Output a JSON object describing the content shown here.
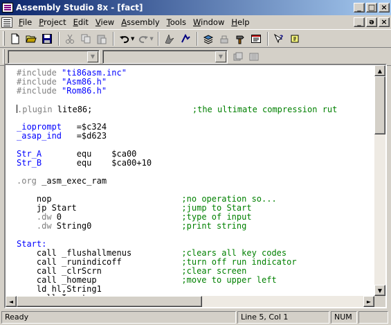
{
  "window": {
    "title": "Assembly Studio 8x - [fact]"
  },
  "caption_buttons": {
    "minimize": "_",
    "maximize": "□",
    "close": "×",
    "restore": "ǝ"
  },
  "menu": [
    {
      "label_u": "F",
      "label_rest": "ile"
    },
    {
      "label_u": "P",
      "label_rest": "roject"
    },
    {
      "label_u": "E",
      "label_rest": "dit"
    },
    {
      "label_u": "V",
      "label_rest": "iew"
    },
    {
      "label_u": "A",
      "label_rest": "ssembly"
    },
    {
      "label_u": "T",
      "label_rest": "ools"
    },
    {
      "label_u": "W",
      "label_rest": "indow"
    },
    {
      "label_u": "H",
      "label_rest": "elp"
    }
  ],
  "toolbar": {
    "icons": [
      "new-file-icon",
      "open-folder-icon",
      "save-icon",
      "cut-icon",
      "copy-icon",
      "paste-icon",
      "undo-icon",
      "redo-icon",
      "find-icon",
      "find-next-icon",
      "stack-icon",
      "build-icon",
      "hammer-icon",
      "window-icon",
      "help-icon",
      "context-help-icon"
    ]
  },
  "combos": {
    "project_value": "",
    "config_value": ""
  },
  "editor": {
    "lines": [
      {
        "segments": [
          {
            "t": "#include ",
            "c": "gray"
          },
          {
            "t": "\"ti86asm.inc\"",
            "c": "blue"
          }
        ]
      },
      {
        "segments": [
          {
            "t": "#include ",
            "c": "gray"
          },
          {
            "t": "\"Asm86.h\"",
            "c": "blue"
          }
        ]
      },
      {
        "segments": [
          {
            "t": "#include ",
            "c": "gray"
          },
          {
            "t": "\"Rom86.h\"",
            "c": "blue"
          }
        ]
      },
      {
        "segments": []
      },
      {
        "segments": [
          {
            "t": "caret",
            "c": "caret"
          },
          {
            "t": ".plugin",
            "c": "gray"
          },
          {
            "t": " lite86;",
            "c": "black"
          },
          {
            "t": "                    ;the ultimate compression rut",
            "c": "green"
          }
        ]
      },
      {
        "segments": []
      },
      {
        "segments": [
          {
            "t": "_ioprompt",
            "c": "blue"
          },
          {
            "t": "   =$c324",
            "c": "black"
          }
        ]
      },
      {
        "segments": [
          {
            "t": "_asap_ind",
            "c": "blue"
          },
          {
            "t": "   =$d623",
            "c": "black"
          }
        ]
      },
      {
        "segments": []
      },
      {
        "segments": [
          {
            "t": "Str_A",
            "c": "blue"
          },
          {
            "t": "       equ    $ca00",
            "c": "black"
          }
        ]
      },
      {
        "segments": [
          {
            "t": "Str_B",
            "c": "blue"
          },
          {
            "t": "       equ    $ca00+10",
            "c": "black"
          }
        ]
      },
      {
        "segments": []
      },
      {
        "segments": [
          {
            "t": ".org",
            "c": "gray"
          },
          {
            "t": " _asm_exec_ram",
            "c": "black"
          }
        ]
      },
      {
        "segments": []
      },
      {
        "segments": [
          {
            "t": "    nop",
            "c": "black"
          },
          {
            "t": "                          ;no operation so...",
            "c": "green"
          }
        ]
      },
      {
        "segments": [
          {
            "t": "    jp Start",
            "c": "black"
          },
          {
            "t": "                     ;jump to Start",
            "c": "green"
          }
        ]
      },
      {
        "segments": [
          {
            "t": "    .dw",
            "c": "gray"
          },
          {
            "t": " 0",
            "c": "black"
          },
          {
            "t": "                        ;type of input",
            "c": "green"
          }
        ]
      },
      {
        "segments": [
          {
            "t": "    .dw",
            "c": "gray"
          },
          {
            "t": " String0",
            "c": "black"
          },
          {
            "t": "                  ;print string",
            "c": "green"
          }
        ]
      },
      {
        "segments": []
      },
      {
        "segments": [
          {
            "t": "Start:",
            "c": "blue"
          }
        ]
      },
      {
        "segments": [
          {
            "t": "    call _flushallmenus",
            "c": "black"
          },
          {
            "t": "          ;clears all key codes",
            "c": "green"
          }
        ]
      },
      {
        "segments": [
          {
            "t": "    call _runindicoff",
            "c": "black"
          },
          {
            "t": "            ;turn off run indicator",
            "c": "green"
          }
        ]
      },
      {
        "segments": [
          {
            "t": "    call _clrScrn",
            "c": "black"
          },
          {
            "t": "                ;clear screen",
            "c": "green"
          }
        ]
      },
      {
        "segments": [
          {
            "t": "    call _homeup",
            "c": "black"
          },
          {
            "t": "                 ;move to upper left",
            "c": "green"
          }
        ]
      },
      {
        "segments": [
          {
            "t": "    ld hl,String1",
            "c": "black"
          }
        ]
      },
      {
        "segments": [
          {
            "t": "    call Input",
            "c": "black"
          }
        ]
      }
    ]
  },
  "scrollbar": {
    "up": "▲",
    "down": "▼",
    "left": "◄",
    "right": "►",
    "vertical_position": 0.0,
    "horizontal_position": 0.0
  },
  "status": {
    "message": "Ready",
    "position": "Line 5, Col 1",
    "num": "NUM"
  },
  "colors": {
    "blue": "#0000ff",
    "gray": "#808080",
    "green": "#008000",
    "black": "#000000",
    "title_start": "#0a246a",
    "title_end": "#a6caf0"
  }
}
